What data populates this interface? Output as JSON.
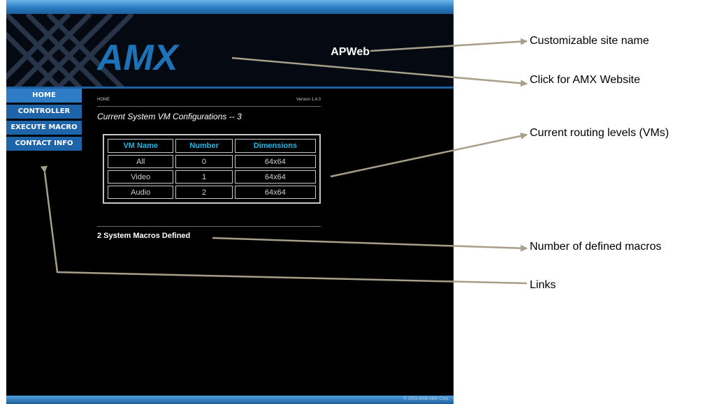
{
  "header": {
    "logo_text": "AMX",
    "site_name": "APWeb"
  },
  "nav": {
    "items": [
      {
        "label": "HOME"
      },
      {
        "label": "CONTROLLER"
      },
      {
        "label": "EXECUTE MACRO"
      },
      {
        "label": "CONTACT INFO"
      }
    ]
  },
  "content": {
    "breadcrumb": "HOME",
    "version": "Version 1.4.0",
    "section_title": "Current System VM Configurations -- 3",
    "table": {
      "headers": [
        "VM Name",
        "Number",
        "Dimensions"
      ],
      "rows": [
        [
          "All",
          "0",
          "64x64"
        ],
        [
          "Video",
          "1",
          "64x64"
        ],
        [
          "Audio",
          "2",
          "64x64"
        ]
      ]
    },
    "macro_count": "2 System Macros Defined"
  },
  "footer": {
    "copyright": "© 2003-2008 AMX Corp."
  },
  "callouts": [
    {
      "label": "Customizable site name"
    },
    {
      "label": "Click for AMX Website"
    },
    {
      "label": "Current routing levels (VMs)"
    },
    {
      "label": "Number of defined macros"
    },
    {
      "label": "Links"
    }
  ],
  "colors": {
    "nav_blue": "#1e64a8",
    "header_accent": "#1fb7e6",
    "callout_line": "#a89f89"
  }
}
